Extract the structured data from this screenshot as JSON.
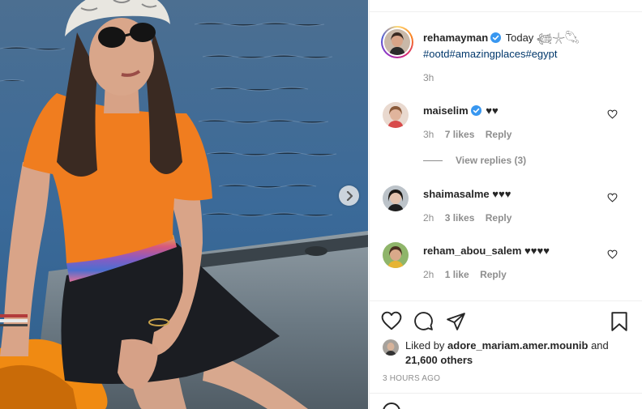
{
  "post": {
    "author": "rehamayman",
    "caption_text": "Today 𓆉𓇼𓆡",
    "hashtags": "#ootd#amazingplaces#egypt",
    "time": "3h",
    "image_alt": "Woman in orange t-shirt, black skirt, bucket hat and sunglasses sitting on an inflatable boat on the water"
  },
  "comments": [
    {
      "user": "maiselim",
      "verified": true,
      "text": "♥♥",
      "time": "3h",
      "likes": "7 likes",
      "reply": "Reply"
    },
    {
      "user": "shaimasalme",
      "verified": false,
      "text": "♥♥♥",
      "time": "2h",
      "likes": "3 likes",
      "reply": "Reply"
    },
    {
      "user": "reham_abou_salem",
      "verified": false,
      "text": "♥♥♥♥",
      "time": "2h",
      "likes": "1 like",
      "reply": "Reply"
    }
  ],
  "view_replies": "View replies (3)",
  "likes": {
    "prefix": "Liked by",
    "user": "adore_mariam.amer.mounib",
    "and": "and",
    "others": "21,600 others"
  },
  "timestamp": "3 HOURS AGO",
  "icons": {
    "like": "heart-icon",
    "comment": "comment-bubble-icon",
    "share": "paper-plane-icon",
    "save": "bookmark-icon",
    "next": "chevron-right-icon",
    "verified": "verified-badge-icon",
    "emoji": "emoji-icon"
  },
  "colors": {
    "verified_blue": "#3897f0",
    "hashtag": "#00376b",
    "muted": "#8e8e8e",
    "text": "#262626"
  }
}
